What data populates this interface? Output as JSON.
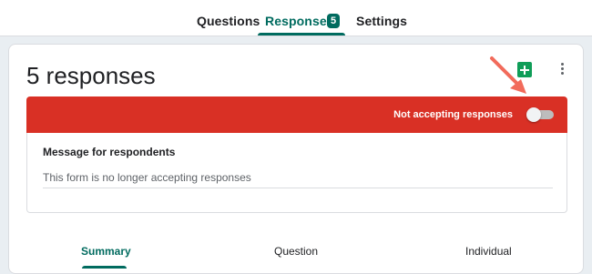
{
  "tabs": [
    {
      "label": "Questions"
    },
    {
      "label": "Responses",
      "badge": "5",
      "active": true
    },
    {
      "label": "Settings"
    }
  ],
  "card": {
    "title": "5 responses",
    "sheets_icon": "google-sheets-icon",
    "more_icon": "more-vert-icon",
    "status_bar": {
      "label": "Not accepting responses",
      "toggle_on": false,
      "color": "#d93025"
    },
    "message": {
      "label": "Message for respondents",
      "text": "This form is no longer accepting responses"
    },
    "subtabs": [
      {
        "label": "Summary",
        "active": true
      },
      {
        "label": "Question"
      },
      {
        "label": "Individual"
      }
    ]
  },
  "colors": {
    "accent": "#006b5f",
    "alert": "#d93025",
    "annotation_arrow": "#f26b5b"
  }
}
